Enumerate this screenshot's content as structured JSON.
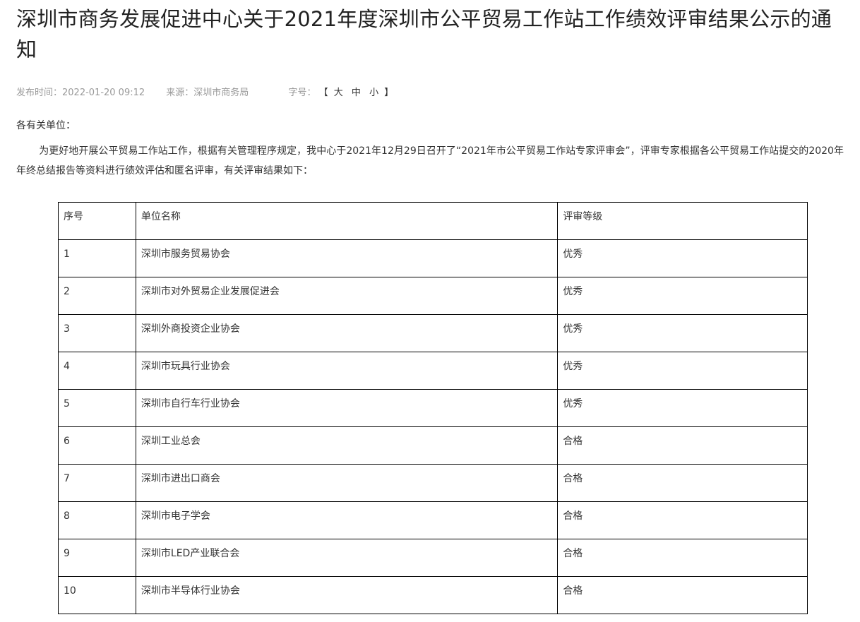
{
  "article": {
    "title": "深圳市商务发展促进中心关于2021年度深圳市公平贸易工作站工作绩效评审结果公示的通知",
    "meta": {
      "publish_time": "发布时间：2022-01-20 09:12",
      "source": "来源：深圳市商务局",
      "font_size_label": "字号：",
      "bracket_open": "【",
      "bracket_close": "】",
      "size_large": "大",
      "size_medium": "中",
      "size_small": "小"
    },
    "salutation": "各有关单位：",
    "intro": "为更好地开展公平贸易工作站工作，根据有关管理程序规定，我中心于2021年12月29日召开了“2021年市公平贸易工作站专家评审会”，评审专家根据各公平贸易工作站提交的2020年年终总结报告等资料进行绩效评估和匿名评审，有关评审结果如下："
  },
  "table": {
    "headers": [
      "序号",
      "单位名称",
      "评审等级"
    ],
    "rows": [
      [
        "1",
        "深圳市服务贸易协会",
        "优秀"
      ],
      [
        "2",
        "深圳市对外贸易企业发展促进会",
        "优秀"
      ],
      [
        "3",
        "深圳外商投资企业协会",
        "优秀"
      ],
      [
        "4",
        "深圳市玩具行业协会",
        "优秀"
      ],
      [
        "5",
        "深圳市自行车行业协会",
        "优秀"
      ],
      [
        "6",
        "深圳工业总会",
        "合格"
      ],
      [
        "7",
        "深圳市进出口商会",
        "合格"
      ],
      [
        "8",
        "深圳市电子学会",
        "合格"
      ],
      [
        "9",
        "深圳市LED产业联合会",
        "合格"
      ],
      [
        "10",
        "深圳市半导体行业协会",
        "合格"
      ]
    ]
  }
}
